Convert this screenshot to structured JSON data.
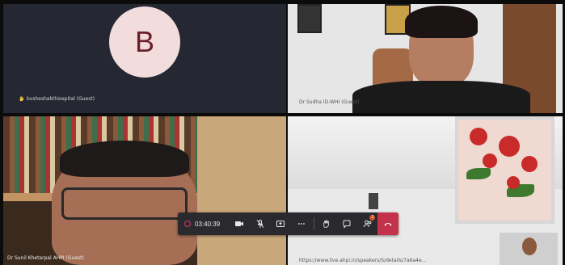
{
  "participants": [
    {
      "initial": "B",
      "name": "bvsheshakthiospital (Guest)",
      "avatar_bg": "#f2dcdc",
      "avatar_fg": "#6b1f2b",
      "hand_raised": true
    },
    {
      "name": "Dr Sudha ID-WHI (Guest)"
    },
    {
      "name": "Dr Sunil Khetarpal AHPI (Guest)"
    },
    {
      "name": "https://www.live.ahpi.in/speakers/S/details/7a6a4e..."
    }
  ],
  "toolbar": {
    "timer": "03:40:39",
    "recording_color": "#d23a6a",
    "leave_color": "#c4314b",
    "participants_count": "2",
    "icons": [
      "camera-icon",
      "mic-off-icon",
      "share-icon",
      "more-icon",
      "raise-hand-icon",
      "chat-icon",
      "people-icon",
      "hangup-icon"
    ]
  }
}
